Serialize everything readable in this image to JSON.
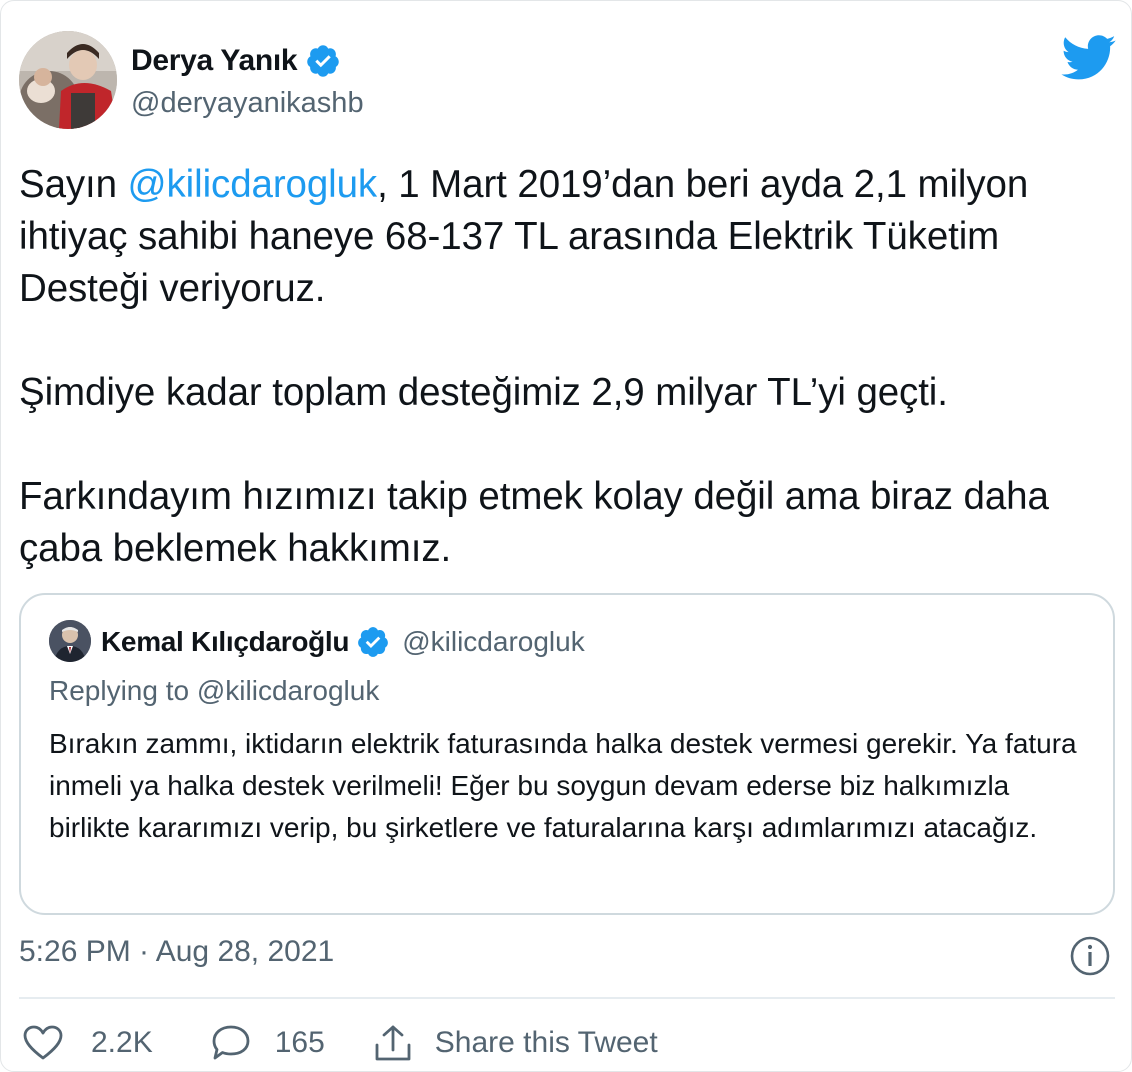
{
  "author": {
    "name": "Derya Yanık",
    "handle": "@deryayanikashb",
    "verified": true
  },
  "tweet": {
    "paragraphs": [
      {
        "prefix": "Sayın ",
        "mention": "@kilicdarogluk",
        "suffix": ", 1 Mart 2019’dan beri ayda 2,1 milyon ihtiyaç sahibi haneye 68-137 TL arasında Elektrik Tüketim Desteği veriyoruz."
      },
      {
        "text": "Şimdiye kadar toplam desteğimiz 2,9 milyar TL’yi geçti."
      },
      {
        "text": "Farkındayım hızımızı takip etmek kolay değil ama biraz daha çaba beklemek hakkımız."
      }
    ],
    "timestamp": "5:26 PM · Aug 28, 2021"
  },
  "quoted_tweet": {
    "name": "Kemal Kılıçdaroğlu",
    "handle": "@kilicdarogluk",
    "verified": true,
    "replying_to": "Replying to @kilicdarogluk",
    "text": "Bırakın zammı, iktidarın elektrik faturasında halka destek vermesi gerekir. Ya fatura inmeli ya halka destek verilmeli! Eğer bu soygun devam ederse biz halkımızla birlikte kararımızı verip, bu şirketlere ve faturalarına karşı adımlarımızı atacağız."
  },
  "actions": {
    "likes": "2.2K",
    "replies": "165",
    "share_label": "Share this Tweet"
  },
  "icons": {
    "brand": "twitter-bird-icon",
    "verified": "verified-badge-icon",
    "info": "info-icon",
    "like": "heart-icon",
    "reply": "speech-bubble-icon",
    "share": "share-icon"
  },
  "colors": {
    "brand_blue": "#1d9bf0",
    "text_primary": "#0f1419",
    "text_secondary": "#536471",
    "border": "#cfd9de"
  }
}
